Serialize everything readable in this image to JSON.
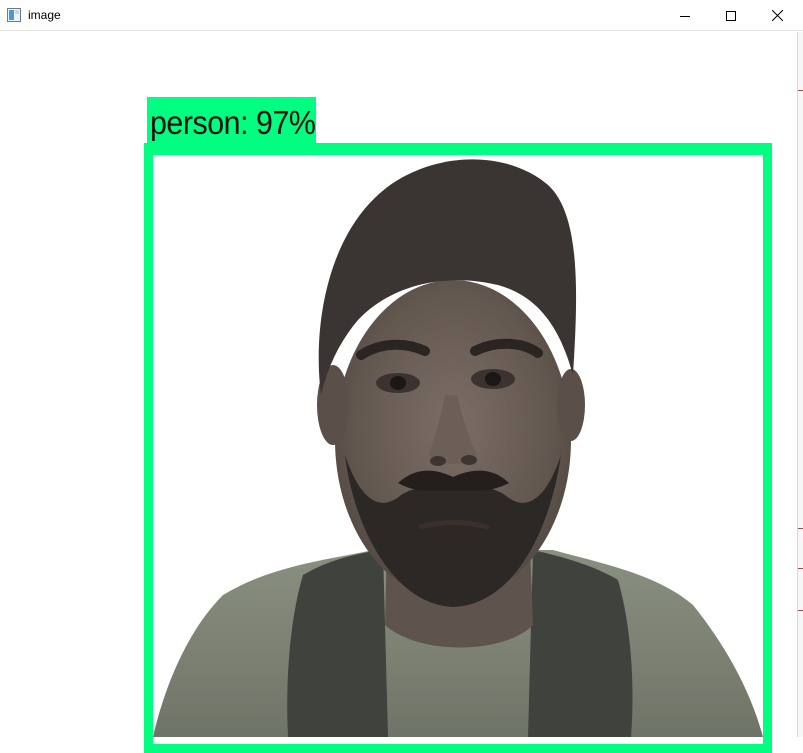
{
  "window": {
    "title": "image",
    "icon": "app-window-icon",
    "controls": [
      "minimize-icon",
      "maximize-icon",
      "close-icon"
    ]
  },
  "detection": {
    "label": "person: 97%",
    "class": "person",
    "confidence": 97,
    "box_color": "#00ff80"
  },
  "image": {
    "subject": "person"
  }
}
